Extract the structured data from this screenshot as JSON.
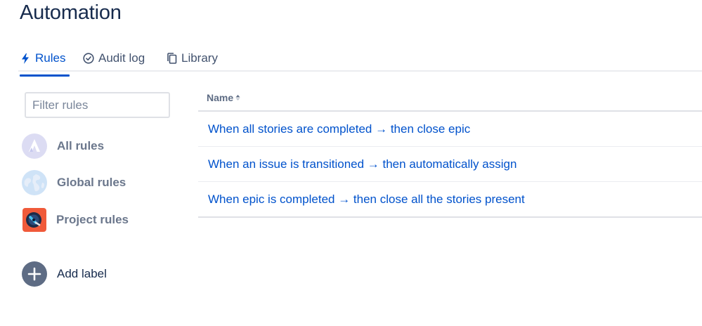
{
  "page": {
    "title": "Automation"
  },
  "tabs": [
    {
      "label": "Rules",
      "icon": "lightning-icon",
      "active": true
    },
    {
      "label": "Audit log",
      "icon": "check-circle-icon",
      "active": false
    },
    {
      "label": "Library",
      "icon": "copy-icon",
      "active": false
    }
  ],
  "sidebar": {
    "filter_placeholder": "Filter rules",
    "items": [
      {
        "label": "All rules",
        "icon": "atlassian-logo-icon"
      },
      {
        "label": "Global rules",
        "icon": "globe-icon"
      },
      {
        "label": "Project rules",
        "icon": "project-avatar-icon"
      }
    ],
    "add_label": {
      "label": "Add label",
      "icon": "plus-icon"
    }
  },
  "table": {
    "column_header": "Name",
    "sort": "ascending",
    "rows": [
      {
        "name": "When all stories are completed → then close epic"
      },
      {
        "name": "When an issue is transitioned → then automatically assign"
      },
      {
        "name": "When epic is completed → then close all the stories present"
      }
    ]
  },
  "colors": {
    "accent": "#0052cc",
    "heading": "#172b4d",
    "muted": "#6b778c",
    "border": "#dfe1e6"
  }
}
